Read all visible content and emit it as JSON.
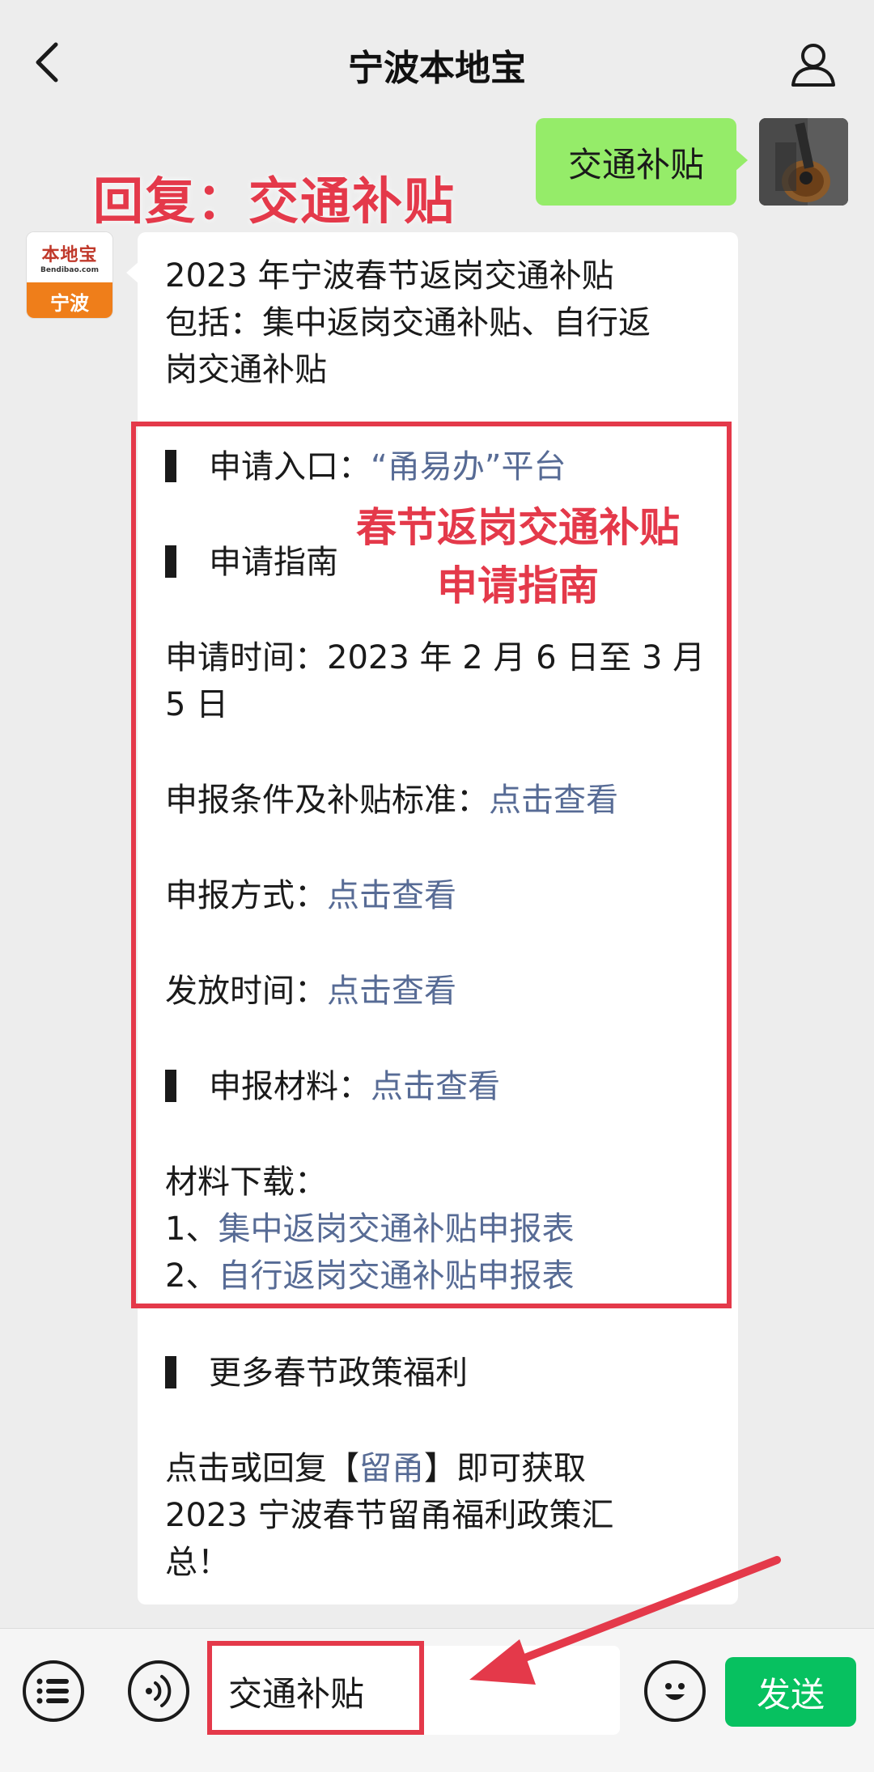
{
  "header": {
    "title": "宁波本地宝"
  },
  "annotations": {
    "reply_hint": "回复：交通补贴",
    "guide_line1": "春节返岗交通补贴",
    "guide_line2": "申请指南"
  },
  "user_message": {
    "text": "交通补贴"
  },
  "bot": {
    "avatar_logo": "本地宝",
    "avatar_domain": "Bendibao.com",
    "avatar_city": "宁波",
    "intro_lines": [
      "2023 年宁波春节返岗交通补贴",
      "包括：集中返岗交通补贴、自行返",
      "岗交通补贴"
    ],
    "entry_label": "申请入口：",
    "entry_link": "“甬易办”平台",
    "guide_heading": "申请指南",
    "apply_time_line1": "申请时间：2023 年 2 月 6 日至 3 月",
    "apply_time_line2": "5 日",
    "conditions_label": "申报条件及补贴标准：",
    "conditions_link": "点击查看",
    "method_label": "申报方式：",
    "method_link": "点击查看",
    "release_label": "发放时间：",
    "release_link": "点击查看",
    "materials_label": "申报材料：",
    "materials_link": "点击查看",
    "download_label": "材料下载：",
    "download1_prefix": "1、",
    "download1_link": "集中返岗交通补贴申报表",
    "download2_prefix": "2、",
    "download2_link": "自行返岗交通补贴申报表",
    "more_heading": "更多春节政策福利",
    "more_line1_a": "点击或回复【",
    "more_line1_link": "留甬",
    "more_line1_b": "】即可获取",
    "more_line2": "2023 宁波春节留甬福利政策汇",
    "more_line3": "总！"
  },
  "input_bar": {
    "input_value": "交通补贴",
    "send_label": "发送"
  },
  "colors": {
    "accent_red": "#e4394a",
    "link": "#576b95",
    "send_green": "#07c160",
    "bubble_green": "#95ec69"
  },
  "icons": [
    "back-chevron-icon",
    "profile-icon",
    "menu-list-icon",
    "voice-icon",
    "emoji-icon"
  ]
}
